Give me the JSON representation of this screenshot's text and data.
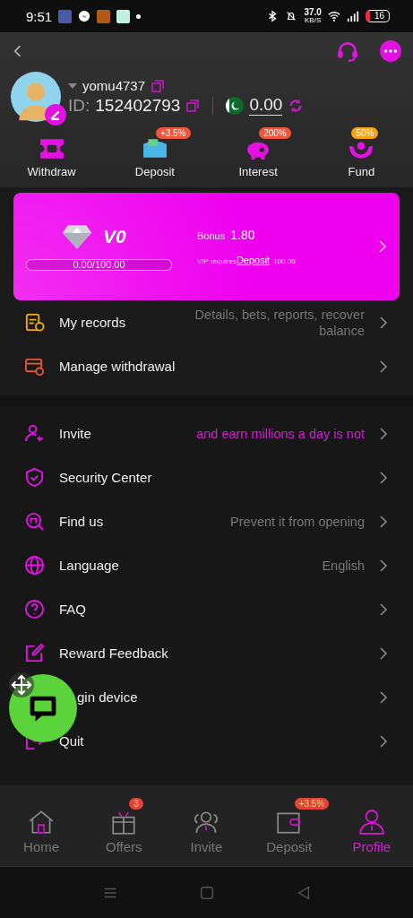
{
  "status_bar": {
    "time": "9:51",
    "speed": "37.0",
    "speed_unit": "KB/S",
    "battery": "16"
  },
  "profile": {
    "username": "yomu4737",
    "id_label": "ID:",
    "id": "152402793",
    "balance": "0.00"
  },
  "shortcuts": [
    {
      "kind": "withdraw",
      "label": "Withdraw"
    },
    {
      "kind": "deposit",
      "label": "Deposit",
      "badge": "+3.5%"
    },
    {
      "kind": "interest",
      "label": "Interest",
      "badge": "200%"
    },
    {
      "kind": "fund",
      "label": "Fund",
      "badge": "50%"
    }
  ],
  "vip": {
    "level_name": "V0",
    "progress": "0.00/100.00",
    "bonus_label": "Bonus",
    "bonus": "1.80",
    "requires": "VIP requires",
    "requires_link": "Deposit",
    "requires_amount": "100.00"
  },
  "records": [
    {
      "kind": "records",
      "label": "My records",
      "value": "Details, bets, reports, recover balance"
    },
    {
      "kind": "withdrawal",
      "label": "Manage withdrawal"
    }
  ],
  "menu": [
    {
      "kind": "invite",
      "label": "Invite",
      "promo_text": "and earn millions a day is not"
    },
    {
      "kind": "security",
      "label": "Security Center"
    },
    {
      "kind": "find",
      "label": "Find us",
      "value": "Prevent it from opening"
    },
    {
      "kind": "language",
      "label": "Language",
      "value": "English"
    },
    {
      "kind": "faq",
      "label": "FAQ"
    },
    {
      "kind": "feedback",
      "label": "Reward Feedback"
    },
    {
      "kind": "device",
      "label": "gin device"
    },
    {
      "kind": "quit",
      "label": "Quit"
    }
  ],
  "tabs": [
    {
      "kind": "home",
      "label": "Home",
      "selected": false
    },
    {
      "kind": "offers",
      "label": "Offers",
      "badge": "3",
      "selected": false
    },
    {
      "kind": "invite",
      "label": "Invite",
      "selected": false
    },
    {
      "kind": "deposit",
      "label": "Deposit",
      "badge": "+3.5%",
      "selected": false
    },
    {
      "kind": "profile",
      "label": "Profile",
      "selected": true
    }
  ]
}
